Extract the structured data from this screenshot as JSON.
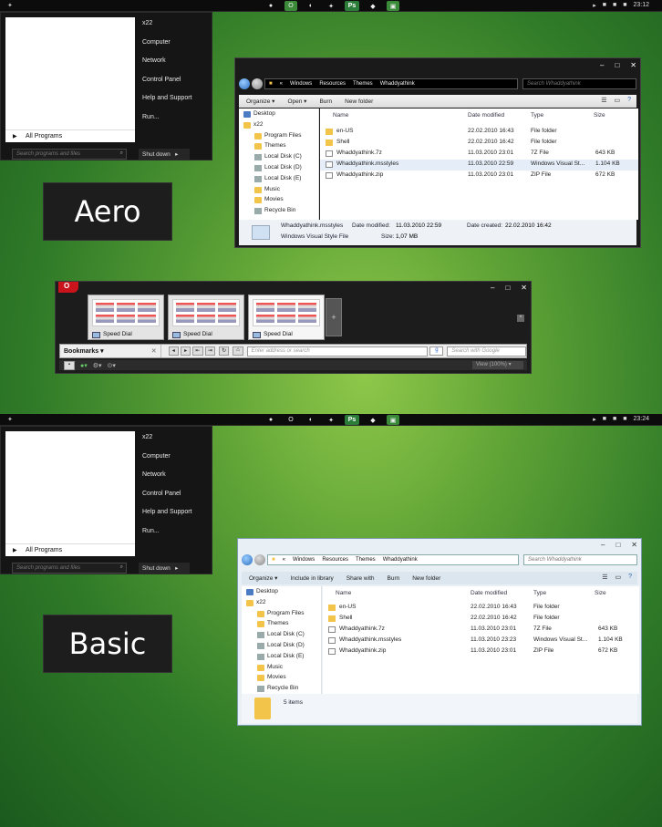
{
  "aero": {
    "taskbar": {
      "start": "✦",
      "time": "23:12"
    },
    "label": "Aero"
  },
  "basic": {
    "taskbar": {
      "start": "✦",
      "time": "23:24"
    },
    "label": "Basic"
  },
  "taskbar_icons": [
    "●",
    "O",
    "◐",
    "✦",
    "Ps",
    "◆",
    "▣"
  ],
  "tray_icons": [
    "▸",
    "■",
    "■",
    "■"
  ],
  "start_menu": {
    "items": [
      "x22",
      "Computer",
      "Network",
      "Control Panel",
      "Help and Support",
      "Run..."
    ],
    "all_programs": "All Programs",
    "search_placeholder": "Search programs and files",
    "shutdown": "Shut down"
  },
  "explorer_aero": {
    "breadcrumb": [
      "«",
      "Windows",
      "Resources",
      "Themes",
      "Whaddyathink"
    ],
    "search_placeholder": "Search Whaddyathink",
    "toolbar": [
      "Organize ▾",
      "Open ▾",
      "Burn",
      "New folder"
    ]
  },
  "explorer_basic": {
    "breadcrumb": [
      "«",
      "Windows",
      "Resources",
      "Themes",
      "Whaddyathink"
    ],
    "search_placeholder": "Search Whaddyathink",
    "toolbar": [
      "Organize ▾",
      "Include in library",
      "Share with",
      "Burn",
      "New folder"
    ],
    "status": "5 items"
  },
  "nav_pane": [
    "Desktop",
    "x22",
    "Program Files",
    "Themes",
    "Local Disk (C)",
    "Local Disk (D)",
    "Local Disk (E)",
    "Music",
    "Movies",
    "Recycle Bin"
  ],
  "columns": {
    "name": "Name",
    "date": "Date modified",
    "type": "Type",
    "size": "Size"
  },
  "files_aero": [
    {
      "name": "en-US",
      "date": "22.02.2010 16:43",
      "type": "File folder",
      "size": ""
    },
    {
      "name": "Shell",
      "date": "22.02.2010 16:42",
      "type": "File folder",
      "size": ""
    },
    {
      "name": "Whaddyathink.7z",
      "date": "11.03.2010 23:01",
      "type": "7Z File",
      "size": "643 KB"
    },
    {
      "name": "Whaddyathink.msstyles",
      "date": "11.03.2010 22:59",
      "type": "Windows Visual St...",
      "size": "1.104 KB"
    },
    {
      "name": "Whaddyathink.zip",
      "date": "11.03.2010 23:01",
      "type": "ZIP File",
      "size": "672 KB"
    }
  ],
  "files_basic": [
    {
      "name": "en-US",
      "date": "22.02.2010 16:43",
      "type": "File folder",
      "size": ""
    },
    {
      "name": "Shell",
      "date": "22.02.2010 16:42",
      "type": "File folder",
      "size": ""
    },
    {
      "name": "Whaddyathink.7z",
      "date": "11.03.2010 23:01",
      "type": "7Z File",
      "size": "643 KB"
    },
    {
      "name": "Whaddyathink.msstyles",
      "date": "11.03.2010 23:23",
      "type": "Windows Visual St...",
      "size": "1.104 KB"
    },
    {
      "name": "Whaddyathink.zip",
      "date": "11.03.2010 23:01",
      "type": "ZIP File",
      "size": "672 KB"
    }
  ],
  "details_aero": {
    "filename": "Whaddyathink.msstyles",
    "modified_label": "Date modified:",
    "modified": "11.03.2010 22:59",
    "created_label": "Date created:",
    "created": "22.02.2010 16:42",
    "filetype": "Windows Visual Style File",
    "size_label": "Size:",
    "size": "1,07 MB"
  },
  "window_controls": [
    "–",
    "□",
    "✕"
  ],
  "opera": {
    "logo": "O",
    "tabs": [
      "Speed Dial",
      "Speed Dial",
      "Speed Dial"
    ],
    "add_tab": "+",
    "bookmarks": "Bookmarks ▾",
    "close": "✕",
    "address_placeholder": "Enter address or search",
    "search_placeholder": "Search with Google",
    "view": "View (100%) ▾"
  }
}
